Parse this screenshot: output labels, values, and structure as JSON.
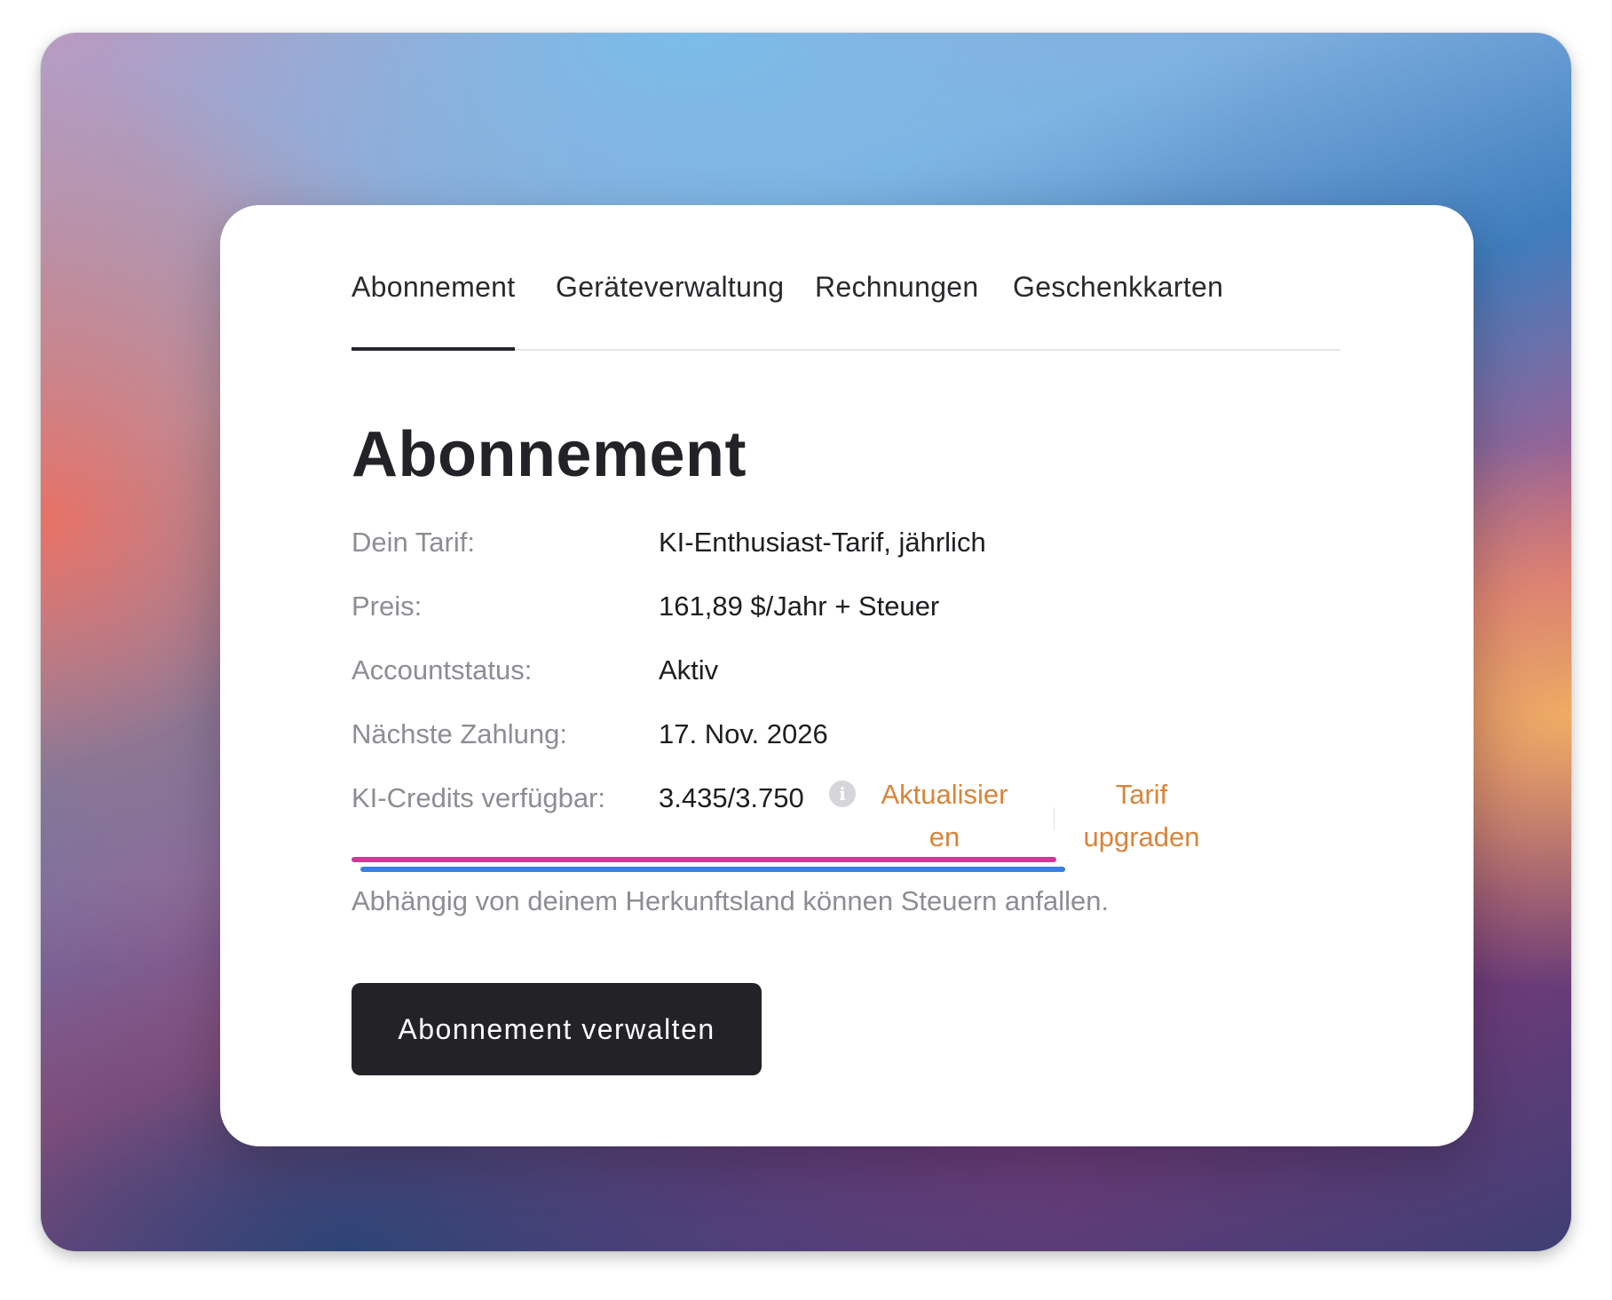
{
  "tabs": [
    {
      "label": "Abonnement",
      "active": true
    },
    {
      "label": "Geräteverwaltung",
      "active": false
    },
    {
      "label": "Rechnungen",
      "active": false
    },
    {
      "label": "Geschenkkarten",
      "active": false
    }
  ],
  "page": {
    "title": "Abonnement"
  },
  "details": {
    "plan": {
      "label": "Dein Tarif:",
      "value": "KI-Enthusiast-Tarif, jährlich"
    },
    "price": {
      "label": "Preis:",
      "value": "161,89 $/Jahr + Steuer"
    },
    "status": {
      "label": "Accountstatus:",
      "value": "Aktiv"
    },
    "next_payment": {
      "label": "Nächste Zahlung:",
      "value": "17. Nov. 2026"
    },
    "credits": {
      "label": "KI-Credits verfügbar:",
      "value": "3.435/3.750",
      "info_icon": "info-icon"
    }
  },
  "links": {
    "refresh": "Aktualisieren",
    "upgrade": "Tarif upgraden"
  },
  "tax_note": "Abhängig von deinem Herkunftsland können Steuern anfallen.",
  "manage_button": "Abonnement verwalten",
  "colors": {
    "accent_link": "#d9843a",
    "button_bg": "#232327",
    "highlight_pink": "#e0309a",
    "highlight_blue": "#3a7ee6"
  }
}
